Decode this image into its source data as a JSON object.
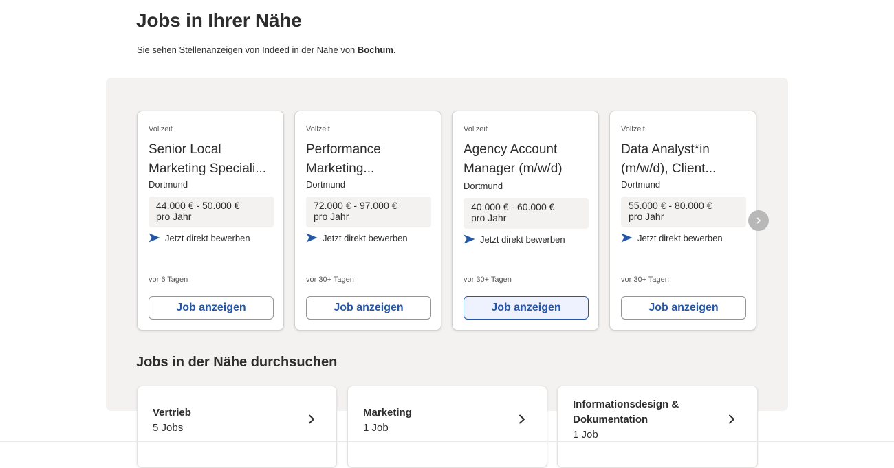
{
  "header": {
    "title": "Jobs in Ihrer Nähe",
    "subtitle_prefix": "Sie sehen Stellenanzeigen von Indeed in der Nähe von ",
    "subtitle_location": "Bochum",
    "subtitle_suffix": "."
  },
  "job_cards": [
    {
      "type": "Vollzeit",
      "title_line1": "Senior Local",
      "title_line2": "Marketing Speciali...",
      "location": "Dortmund",
      "salary_line1": "44.000 € - 50.000 €",
      "salary_line2": "pro Jahr",
      "apply_label": "Jetzt direkt bewerben",
      "posted": "vor 6 Tagen",
      "button_label": "Job anzeigen"
    },
    {
      "type": "Vollzeit",
      "title_line1": "Performance",
      "title_line2": "Marketing...",
      "location": "Dortmund",
      "salary_line1": "72.000 € - 97.000 €",
      "salary_line2": "pro Jahr",
      "apply_label": "Jetzt direkt bewerben",
      "posted": "vor 30+ Tagen",
      "button_label": "Job anzeigen"
    },
    {
      "type": "Vollzeit",
      "title_line1": "Agency Account",
      "title_line2": "Manager (m/w/d)",
      "location": "Dortmund",
      "salary_line1": "40.000 € - 60.000 €",
      "salary_line2": "pro Jahr",
      "apply_label": "Jetzt direkt bewerben",
      "posted": "vor 30+ Tagen",
      "button_label": "Job anzeigen"
    },
    {
      "type": "Vollzeit",
      "title_line1": "Data Analyst*in",
      "title_line2": "(m/w/d), Client...",
      "location": "Dortmund",
      "salary_line1": "55.000 € - 80.000 €",
      "salary_line2": "pro Jahr",
      "apply_label": "Jetzt direkt bewerben",
      "posted": "vor 30+ Tagen",
      "button_label": "Job anzeigen"
    }
  ],
  "carousel": {
    "next_icon": "chevron-right-icon"
  },
  "browse": {
    "title": "Jobs in der Nähe durchsuchen",
    "categories": [
      {
        "name": "Vertrieb",
        "count": "5 Jobs"
      },
      {
        "name": "Marketing",
        "count": "1 Job"
      },
      {
        "name": "Informationsdesign & Dokumentation",
        "count": "1 Job"
      }
    ]
  },
  "colors": {
    "accent": "#2557a7",
    "panel_bg": "#f3f2f1",
    "text": "#2d2d2d"
  },
  "icons": {
    "apply": "send-arrow-icon",
    "category": "chevron-right-icon"
  }
}
